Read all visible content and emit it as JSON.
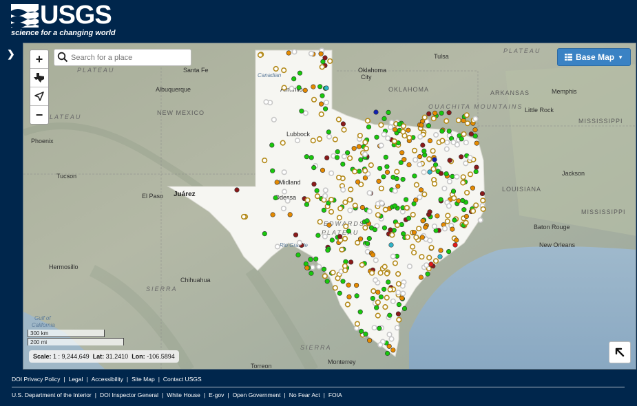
{
  "header": {
    "logo_text": "USGS",
    "tagline": "science for a changing world"
  },
  "map": {
    "search_placeholder": "Search for a place",
    "basemap_label": "Base Map",
    "scale": {
      "km": "300 km",
      "mi": "200 mi"
    },
    "readout": {
      "scale_label": "Scale:",
      "scale_value": "1 : 9,244,649",
      "lat_label": "Lat:",
      "lat_value": "31.2410",
      "lon_label": "Lon:",
      "lon_value": "-106.5894"
    },
    "place_labels": [
      {
        "text": "PLATEAU",
        "cls": "region"
      },
      {
        "text": "Santa Fe",
        "cls": "city"
      },
      {
        "text": "Albuquerque",
        "cls": "city"
      },
      {
        "text": "NEW MEXICO",
        "cls": "state"
      },
      {
        "text": "Phoenix",
        "cls": "city"
      },
      {
        "text": "Tucson",
        "cls": "city"
      },
      {
        "text": "Juárez",
        "cls": "bigcity"
      },
      {
        "text": "El Paso",
        "cls": "city"
      },
      {
        "text": "Hermosillo",
        "cls": "city"
      },
      {
        "text": "Chihuahua",
        "cls": "city"
      },
      {
        "text": "Torreon",
        "cls": "city"
      },
      {
        "text": "Monterrey",
        "cls": "city"
      },
      {
        "text": "Amarillo",
        "cls": "city"
      },
      {
        "text": "Lubbock",
        "cls": "city"
      },
      {
        "text": "Midland",
        "cls": "city"
      },
      {
        "text": "Odessa",
        "cls": "city"
      },
      {
        "text": "EDWARDS",
        "cls": "region"
      },
      {
        "text": "PLATEAU",
        "cls": "region"
      },
      {
        "text": "Oklahoma",
        "cls": "city"
      },
      {
        "text": "City",
        "cls": "city"
      },
      {
        "text": "OKLAHOMA",
        "cls": "state"
      },
      {
        "text": "Tulsa",
        "cls": "city"
      },
      {
        "text": "PLATEAU",
        "cls": "region"
      },
      {
        "text": "ARKANSAS",
        "cls": "state"
      },
      {
        "text": "Memphis",
        "cls": "city"
      },
      {
        "text": "OUACHITA MOUNTAINS",
        "cls": "region"
      },
      {
        "text": "Little Rock",
        "cls": "city"
      },
      {
        "text": "MISSISSIPPI",
        "cls": "state"
      },
      {
        "text": "Jackson",
        "cls": "city"
      },
      {
        "text": "LOUISIANA",
        "cls": "state"
      },
      {
        "text": "MISSISSIPPI",
        "cls": "state"
      },
      {
        "text": "Baton Rouge",
        "cls": "city"
      },
      {
        "text": "New Orleans",
        "cls": "city"
      },
      {
        "text": "Gulf of",
        "cls": "water"
      },
      {
        "text": "California",
        "cls": "water"
      },
      {
        "text": "SIERRA",
        "cls": "region"
      },
      {
        "text": "SIERRA",
        "cls": "region"
      },
      {
        "text": "PLATEAU",
        "cls": "region"
      },
      {
        "text": "Rio Grande",
        "cls": "water"
      },
      {
        "text": "Canadian",
        "cls": "water"
      }
    ]
  },
  "footer": {
    "row1": [
      "DOI Privacy Policy",
      "Legal",
      "Accessibility",
      "Site Map",
      "Contact USGS"
    ],
    "row2": [
      "U.S. Department of the Interior",
      "DOI Inspector General",
      "White House",
      "E-gov",
      "Open Government",
      "No Fear Act",
      "FOIA"
    ]
  },
  "colors": {
    "header_bg": "#00264c",
    "button_blue": "#3a82c4",
    "site_green": "#18c80c",
    "site_orange": "#e58a00",
    "site_darkred": "#8b1a1a",
    "site_open_gold": "#b38a1a",
    "site_gray": "#c8c8c8",
    "site_cyan": "#2fb5c9",
    "site_blue": "#1020b0",
    "site_red": "#e21a1a"
  }
}
